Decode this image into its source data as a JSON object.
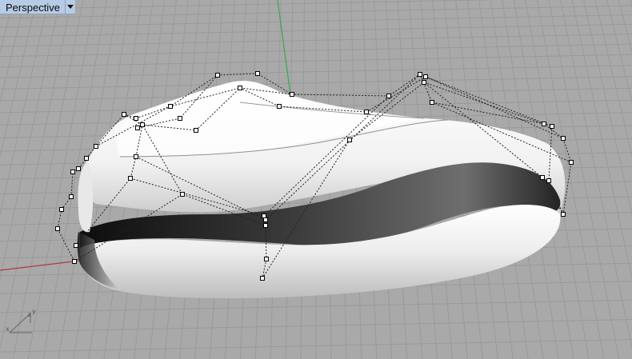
{
  "viewport": {
    "title": "Perspective",
    "menu_icon": "chevron-down-icon"
  },
  "axis_indicator": {
    "x": "x",
    "y": "y",
    "z": "z"
  },
  "colors": {
    "background": "#a9a9a9",
    "grid": "#9a9a9a",
    "label_bg": "#b6cce6",
    "x_axis": "#b03a3a",
    "y_axis": "#3aa84a",
    "surface": "#f2f2f2",
    "control_points": "#000000"
  }
}
